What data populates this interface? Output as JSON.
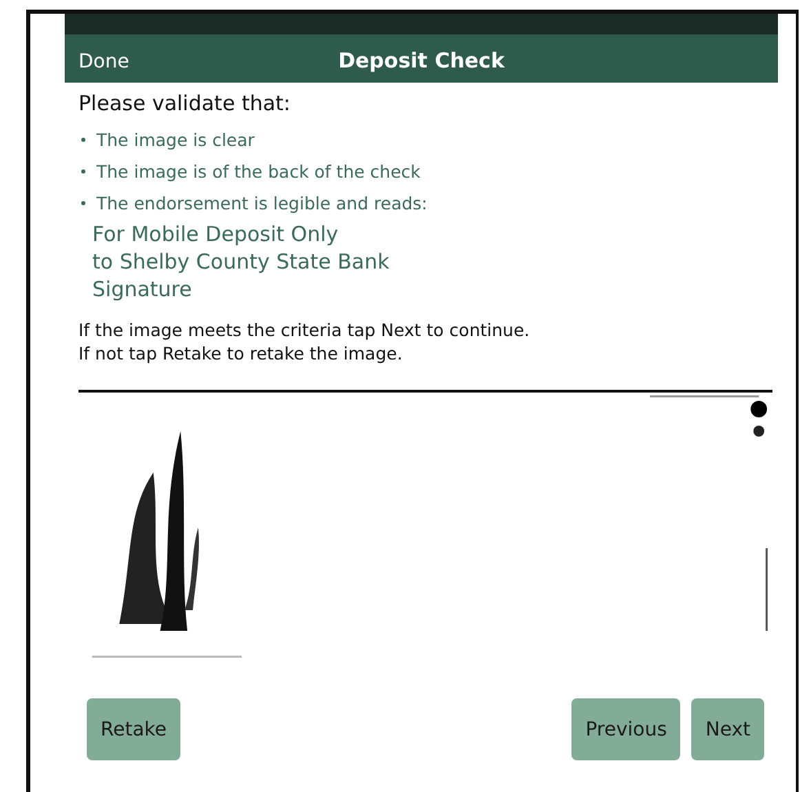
{
  "header": {
    "left_button": "Done",
    "title": "Deposit Check"
  },
  "heading": "Please validate that:",
  "checklist": [
    "The image is clear",
    "The image is of the back of the check",
    "The endorsement is legible and reads:"
  ],
  "endorsement": [
    "For Mobile Deposit Only",
    "to Shelby County State Bank",
    "Signature"
  ],
  "instructions": [
    "If the image meets the criteria tap Next to continue.",
    "If not tap Retake to retake the image."
  ],
  "check_image": {
    "kind": "picture"
  },
  "buttons": {
    "left": [
      "Retake"
    ],
    "right": [
      "Previous",
      "Next"
    ]
  }
}
